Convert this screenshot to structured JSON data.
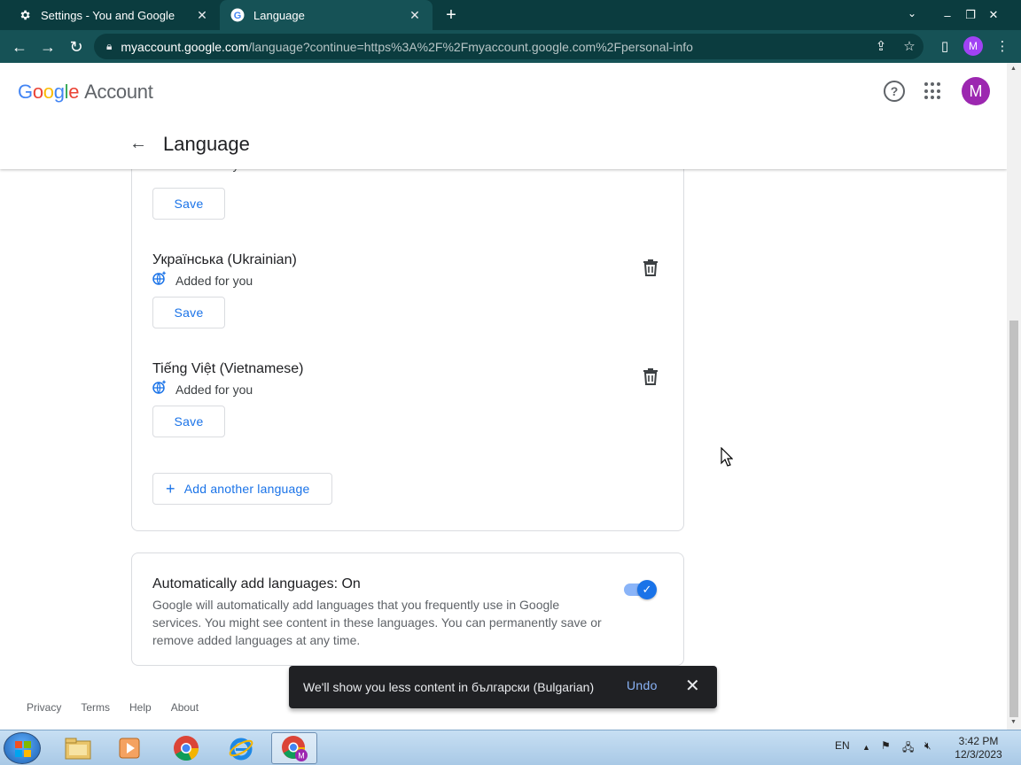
{
  "browser": {
    "tabs": [
      {
        "title": "Settings - You and Google",
        "icon": "gear-icon",
        "active": false
      },
      {
        "title": "Language",
        "icon": "google-g-icon",
        "active": true
      }
    ],
    "url_host": "myaccount.google.com",
    "url_rest": "/language?continue=https%3A%2F%2Fmyaccount.google.com%2Fpersonal-info",
    "profile_initial": "M"
  },
  "header": {
    "logo_letters": [
      "G",
      "o",
      "o",
      "g",
      "l",
      "e"
    ],
    "logo_suffix": "Account",
    "avatar_initial": "M"
  },
  "page": {
    "title": "Language",
    "languages": [
      {
        "name": "",
        "sublabel": "Added for you",
        "save_label": "Save"
      },
      {
        "name": "Українська (Ukrainian)",
        "sublabel": "Added for you",
        "save_label": "Save"
      },
      {
        "name": "Tiếng Việt (Vietnamese)",
        "sublabel": "Added for you",
        "save_label": "Save"
      }
    ],
    "add_language_label": "Add another language",
    "auto_add": {
      "title": "Automatically add languages: On",
      "description": "Google will automatically add languages that you frequently use in Google services. You might see content in these languages. You can permanently save or remove added languages at any time.",
      "enabled": true
    }
  },
  "footer": {
    "links": [
      "Privacy",
      "Terms",
      "Help",
      "About"
    ]
  },
  "snackbar": {
    "message": "We'll show you less content in български (Bulgarian)",
    "action": "Undo"
  },
  "taskbar": {
    "language": "EN",
    "time": "3:42 PM",
    "date": "12/3/2023"
  },
  "colors": {
    "accent": "#1a73e8",
    "tab_strip": "#0b3c3f",
    "toolbar": "#165256",
    "avatar": "#9c27b0"
  }
}
